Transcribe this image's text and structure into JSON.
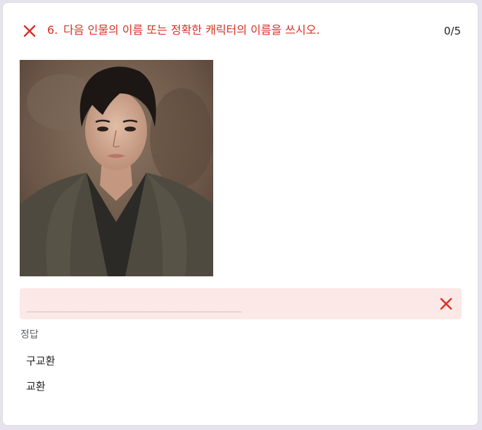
{
  "question": {
    "number": "6.",
    "text": "다음 인물의 이름 또는 정확한 캐릭터의 이름을 쓰시오.",
    "score": "0/5"
  },
  "answer": {
    "value": ""
  },
  "correct": {
    "label": "정답",
    "answers": [
      "구교환",
      "교환"
    ]
  },
  "colors": {
    "incorrect": "#d93025",
    "incorrect_bg": "#fce8e6"
  }
}
